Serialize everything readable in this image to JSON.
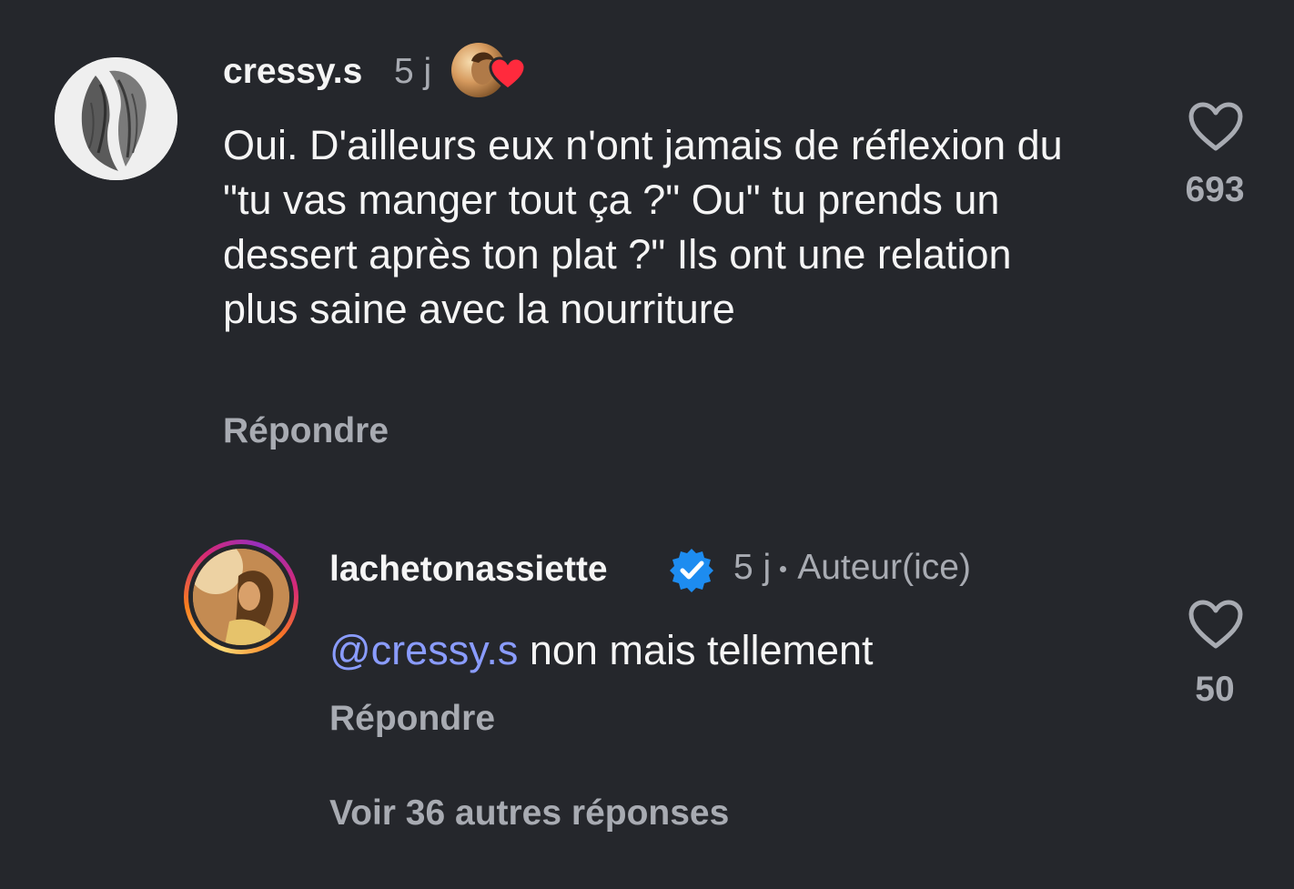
{
  "comment": {
    "username": "cressy.s",
    "time": "5 j",
    "text": "Oui. D'ailleurs eux n'ont jamais de réflexion du \"tu vas manger tout ça ?\" Ou\" tu prends un dessert après ton plat ?\" Ils ont une relation plus saine avec la nourriture",
    "likes": "693",
    "reply_label": "Répondre",
    "liked_by_creator_icon": "creator-heart-icon"
  },
  "reply": {
    "username": "lachetonassiette",
    "verified_icon": "verified-badge-icon",
    "time": "5 j",
    "author_label": "Auteur(ice)",
    "mention": "@cressy.s",
    "text": "non mais tellement",
    "likes": "50",
    "reply_label": "Répondre"
  },
  "more_replies_label": "Voir 36 autres réponses",
  "colors": {
    "background": "#25272c",
    "text": "#f5f5f5",
    "muted": "#a8abb2",
    "mention": "#8a9cff",
    "verified": "#1d8cf0",
    "heart_red": "#ff2a3d"
  }
}
